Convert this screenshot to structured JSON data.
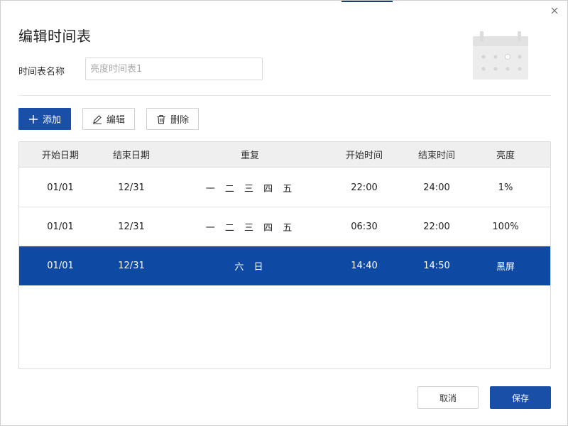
{
  "dialog": {
    "title": "编辑时间表",
    "name_label": "时间表名称",
    "name_placeholder": "亮度时间表1",
    "name_value": ""
  },
  "toolbar": {
    "add_label": "添加",
    "edit_label": "编辑",
    "delete_label": "删除"
  },
  "table": {
    "headers": [
      "开始日期",
      "结束日期",
      "重复",
      "开始时间",
      "结束时间",
      "亮度"
    ],
    "rows": [
      {
        "start_date": "01/01",
        "end_date": "12/31",
        "repeat": "一 二 三 四 五",
        "start_time": "22:00",
        "end_time": "24:00",
        "brightness": "1%",
        "selected": false
      },
      {
        "start_date": "01/01",
        "end_date": "12/31",
        "repeat": "一 二 三 四 五",
        "start_time": "06:30",
        "end_time": "22:00",
        "brightness": "100%",
        "selected": false
      },
      {
        "start_date": "01/01",
        "end_date": "12/31",
        "repeat": "六 日",
        "start_time": "14:40",
        "end_time": "14:50",
        "brightness": "黑屏",
        "selected": true
      }
    ]
  },
  "footer": {
    "cancel_label": "取消",
    "save_label": "保存"
  },
  "colors": {
    "primary": "#1a4fa8",
    "selected_row": "#0e4aa3",
    "header_bg": "#efefef"
  },
  "icons": {
    "close": "close-icon",
    "calendar": "calendar-icon",
    "add": "plus-icon",
    "edit": "pencil-icon",
    "delete": "trash-icon"
  }
}
